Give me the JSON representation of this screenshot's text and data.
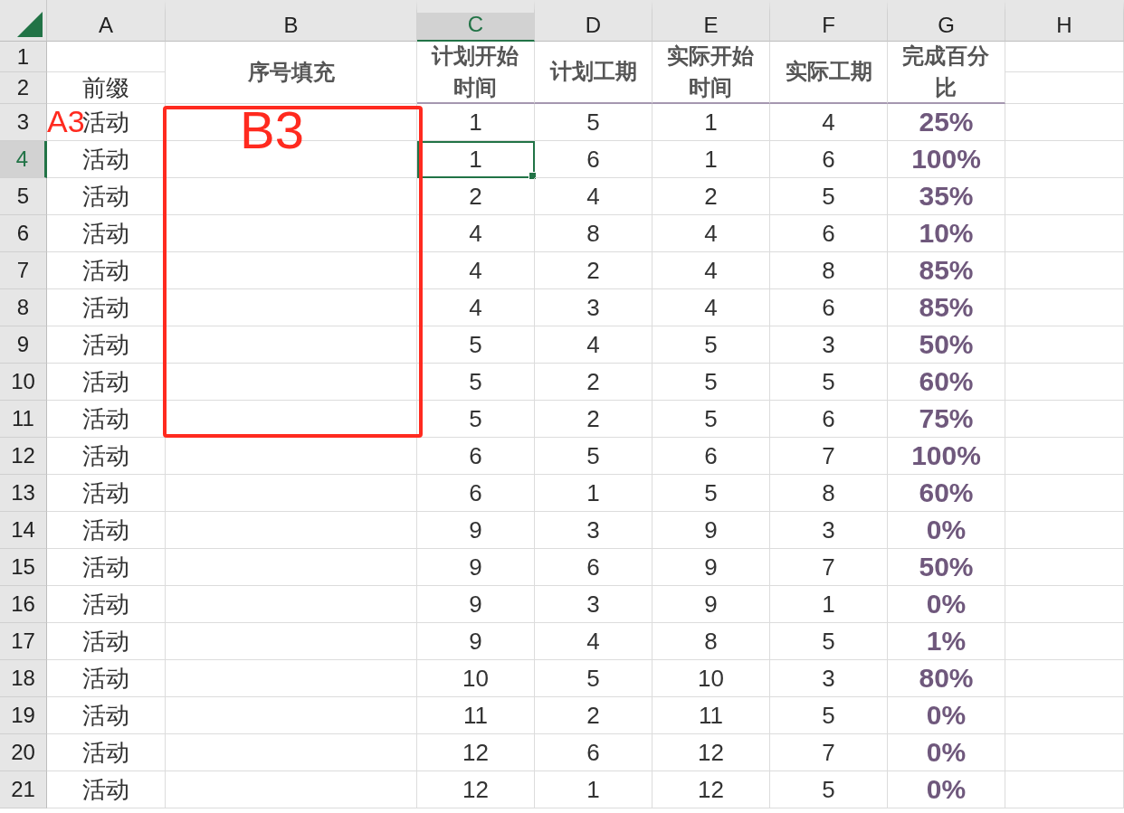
{
  "columns": [
    {
      "label": "A",
      "selected": false
    },
    {
      "label": "B",
      "selected": false
    },
    {
      "label": "C",
      "selected": true
    },
    {
      "label": "D",
      "selected": false
    },
    {
      "label": "E",
      "selected": false
    },
    {
      "label": "F",
      "selected": false
    },
    {
      "label": "G",
      "selected": false
    },
    {
      "label": "H",
      "selected": false
    }
  ],
  "header_rows": [
    {
      "number": "1",
      "selected": false
    },
    {
      "number": "2",
      "selected": false
    }
  ],
  "header": {
    "prefix": "前缀",
    "fill": "序号填充",
    "titles": [
      "计划开始时间",
      "计划工期",
      "实际开始时间",
      "实际工期",
      "完成百分比"
    ]
  },
  "rows": [
    {
      "number": "3",
      "selected": false,
      "prefix": "活动",
      "values": [
        "1",
        "5",
        "1",
        "4",
        "25%"
      ]
    },
    {
      "number": "4",
      "selected": true,
      "prefix": "活动",
      "values": [
        "1",
        "6",
        "1",
        "6",
        "100%"
      ]
    },
    {
      "number": "5",
      "selected": false,
      "prefix": "活动",
      "values": [
        "2",
        "4",
        "2",
        "5",
        "35%"
      ]
    },
    {
      "number": "6",
      "selected": false,
      "prefix": "活动",
      "values": [
        "4",
        "8",
        "4",
        "6",
        "10%"
      ]
    },
    {
      "number": "7",
      "selected": false,
      "prefix": "活动",
      "values": [
        "4",
        "2",
        "4",
        "8",
        "85%"
      ]
    },
    {
      "number": "8",
      "selected": false,
      "prefix": "活动",
      "values": [
        "4",
        "3",
        "4",
        "6",
        "85%"
      ]
    },
    {
      "number": "9",
      "selected": false,
      "prefix": "活动",
      "values": [
        "5",
        "4",
        "5",
        "3",
        "50%"
      ]
    },
    {
      "number": "10",
      "selected": false,
      "prefix": "活动",
      "values": [
        "5",
        "2",
        "5",
        "5",
        "60%"
      ]
    },
    {
      "number": "11",
      "selected": false,
      "prefix": "活动",
      "values": [
        "5",
        "2",
        "5",
        "6",
        "75%"
      ]
    },
    {
      "number": "12",
      "selected": false,
      "prefix": "活动",
      "values": [
        "6",
        "5",
        "6",
        "7",
        "100%"
      ]
    },
    {
      "number": "13",
      "selected": false,
      "prefix": "活动",
      "values": [
        "6",
        "1",
        "5",
        "8",
        "60%"
      ]
    },
    {
      "number": "14",
      "selected": false,
      "prefix": "活动",
      "values": [
        "9",
        "3",
        "9",
        "3",
        "0%"
      ]
    },
    {
      "number": "15",
      "selected": false,
      "prefix": "活动",
      "values": [
        "9",
        "6",
        "9",
        "7",
        "50%"
      ]
    },
    {
      "number": "16",
      "selected": false,
      "prefix": "活动",
      "values": [
        "9",
        "3",
        "9",
        "1",
        "0%"
      ]
    },
    {
      "number": "17",
      "selected": false,
      "prefix": "活动",
      "values": [
        "9",
        "4",
        "8",
        "5",
        "1%"
      ]
    },
    {
      "number": "18",
      "selected": false,
      "prefix": "活动",
      "values": [
        "10",
        "5",
        "10",
        "3",
        "80%"
      ]
    },
    {
      "number": "19",
      "selected": false,
      "prefix": "活动",
      "values": [
        "11",
        "2",
        "11",
        "5",
        "0%"
      ]
    },
    {
      "number": "20",
      "selected": false,
      "prefix": "活动",
      "values": [
        "12",
        "6",
        "12",
        "7",
        "0%"
      ]
    },
    {
      "number": "21",
      "selected": false,
      "prefix": "活动",
      "values": [
        "12",
        "1",
        "12",
        "5",
        "0%"
      ]
    }
  ],
  "annotations": [
    {
      "kind": "box"
    },
    {
      "kind": "label",
      "text": "A3"
    },
    {
      "kind": "label",
      "text": "B3"
    }
  ]
}
